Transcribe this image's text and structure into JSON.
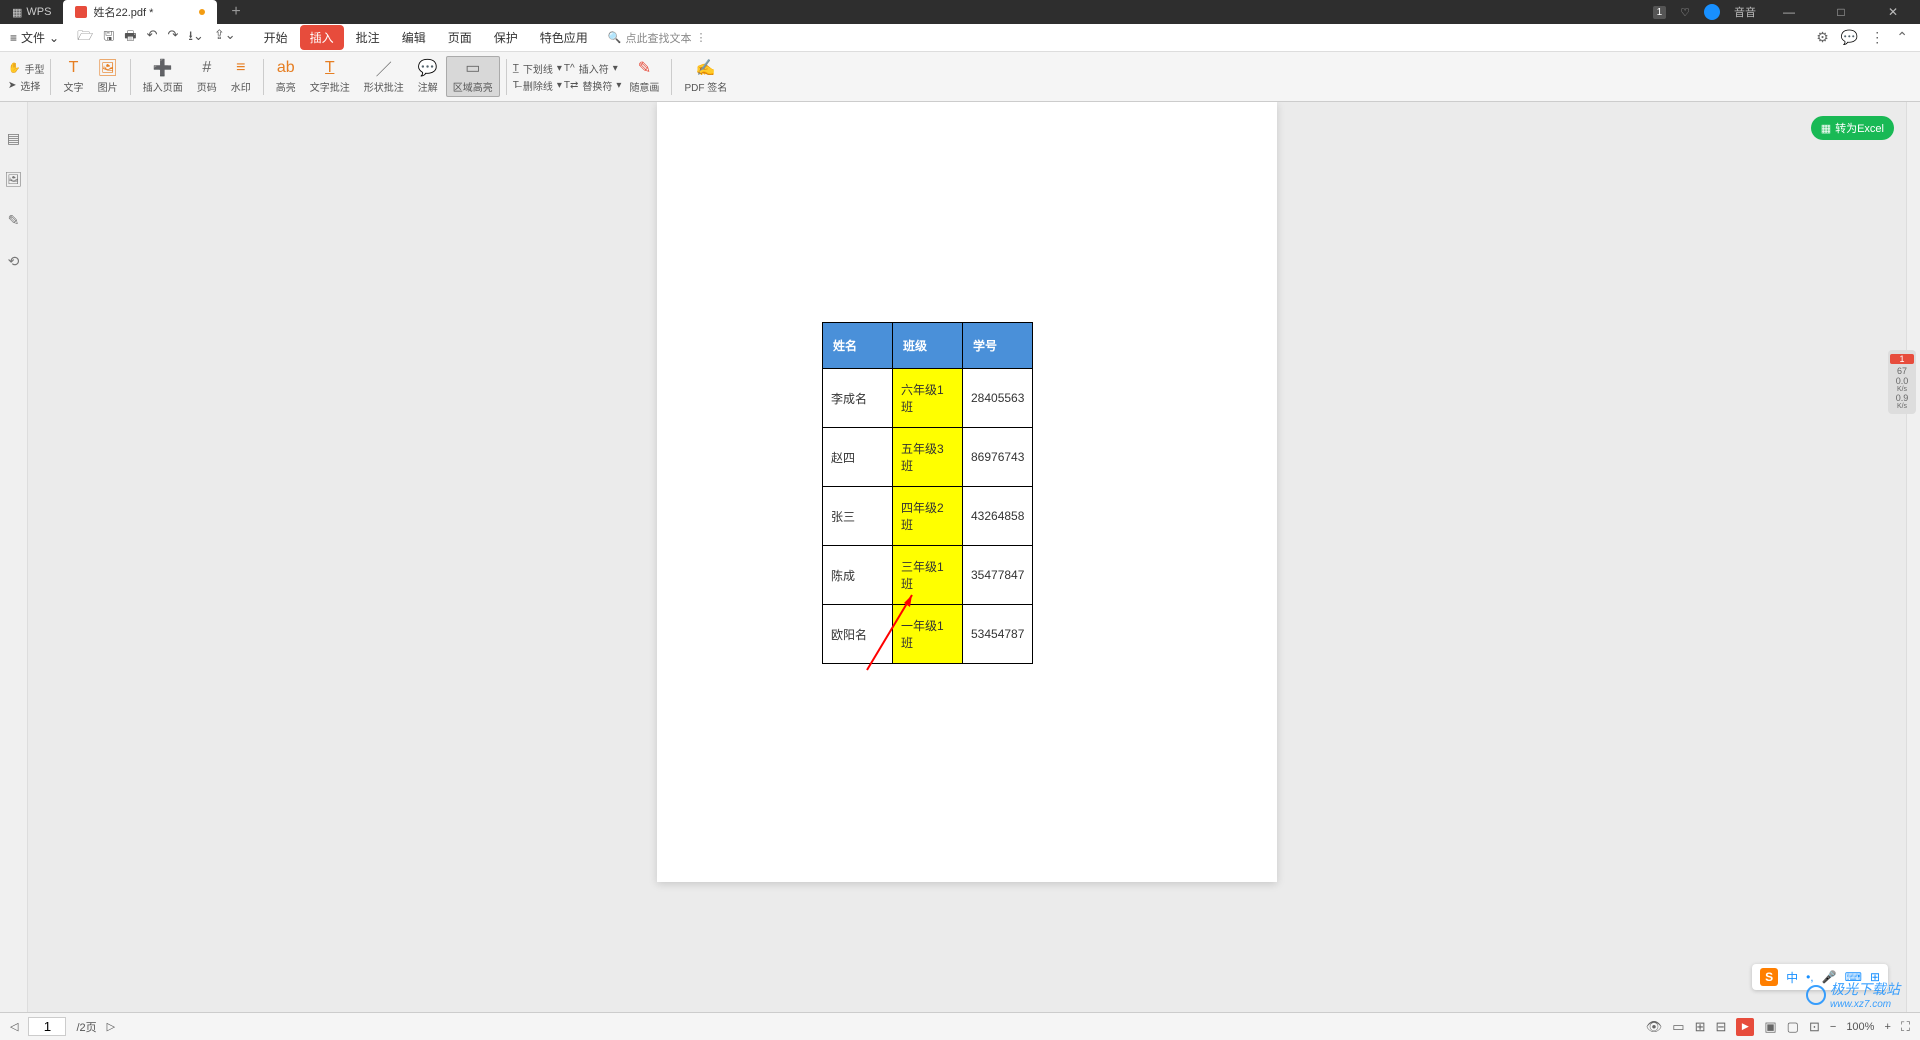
{
  "title": {
    "app": "WPS",
    "tab": "姓名22.pdf *"
  },
  "window": {
    "notif": "1",
    "user": "音音"
  },
  "file_menu": "文件",
  "menuTabs": [
    "开始",
    "插入",
    "批注",
    "编辑",
    "页面",
    "保护",
    "特色应用"
  ],
  "activeMenu": 1,
  "search_placeholder": "点此查找文本",
  "ribbon": {
    "hand": "手型",
    "select": "选择",
    "text": "文字",
    "image": "图片",
    "insertPage": "插入页面",
    "pageNum": "页码",
    "watermark": "水印",
    "highlight": "高亮",
    "textAnnot": "文字批注",
    "shapeAnnot": "形状批注",
    "annotate": "注解",
    "areaHighlight": "区域高亮",
    "underline": "下划线",
    "insertMark": "插入符",
    "strike": "删除线",
    "replaceMark": "替换符",
    "freehand": "随意画",
    "sign": "PDF 签名"
  },
  "convert": "转为Excel",
  "table": {
    "headers": [
      "姓名",
      "班级",
      "学号"
    ],
    "rows": [
      [
        "李成名",
        "六年级1班",
        "28405563"
      ],
      [
        "赵四",
        "五年级3班",
        "86976743"
      ],
      [
        "张三",
        "四年级2班",
        "43264858"
      ],
      [
        "陈成",
        "三年级1班",
        "35477847"
      ],
      [
        "欧阳名",
        "一年级1班",
        "53454787"
      ]
    ]
  },
  "status": {
    "page": "1",
    "total": "/2页",
    "zoom": "100%"
  },
  "perf": {
    "badge": "1",
    "v1": "67",
    "v2": "0.0",
    "u2": "K/s",
    "v3": "0.9",
    "u3": "K/s"
  },
  "ime": {
    "lang": "中",
    "punct": "•,",
    "mic": "🎤",
    "kb": "⌨",
    "grid": "⊞"
  },
  "watermark": "极光下载站",
  "watermark_url": "www.xz7.com"
}
